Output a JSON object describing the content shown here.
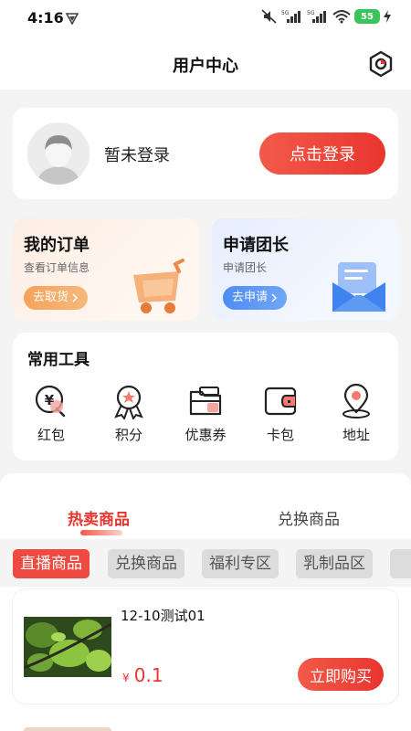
{
  "status_bar": {
    "time": "4:16",
    "battery": "55"
  },
  "nav": {
    "title": "用户中心",
    "settings_icon": "settings-hexagon-icon"
  },
  "profile": {
    "status_text": "暂未登录",
    "login_button": "点击登录",
    "avatar_icon": "default-avatar-icon"
  },
  "orders": {
    "title": "我的订单",
    "subtitle": "查看订单信息",
    "button": "去取货",
    "icon": "cart-icon"
  },
  "leader": {
    "title": "申请团长",
    "subtitle": "申请团长",
    "button": "去申请",
    "icon": "envelope-icon"
  },
  "tools": {
    "title": "常用工具",
    "items": [
      {
        "label": "红包",
        "icon": "red-packet-icon"
      },
      {
        "label": "积分",
        "icon": "points-medal-icon"
      },
      {
        "label": "优惠券",
        "icon": "coupon-folder-icon"
      },
      {
        "label": "卡包",
        "icon": "wallet-icon"
      },
      {
        "label": "地址",
        "icon": "location-pin-icon"
      }
    ]
  },
  "tabs": {
    "hot": "热卖商品",
    "exchange": "兑换商品"
  },
  "categories": [
    "直播商品",
    "兑换商品",
    "福利专区",
    "乳制品区"
  ],
  "product": {
    "name": "12-10测试01",
    "currency": "¥",
    "price": "0.1",
    "buy_button": "立即购买"
  },
  "colors": {
    "accent": "#e8352f",
    "orange": "#f7a25c",
    "blue": "#4e8cf2",
    "background": "#f4f4f4"
  }
}
